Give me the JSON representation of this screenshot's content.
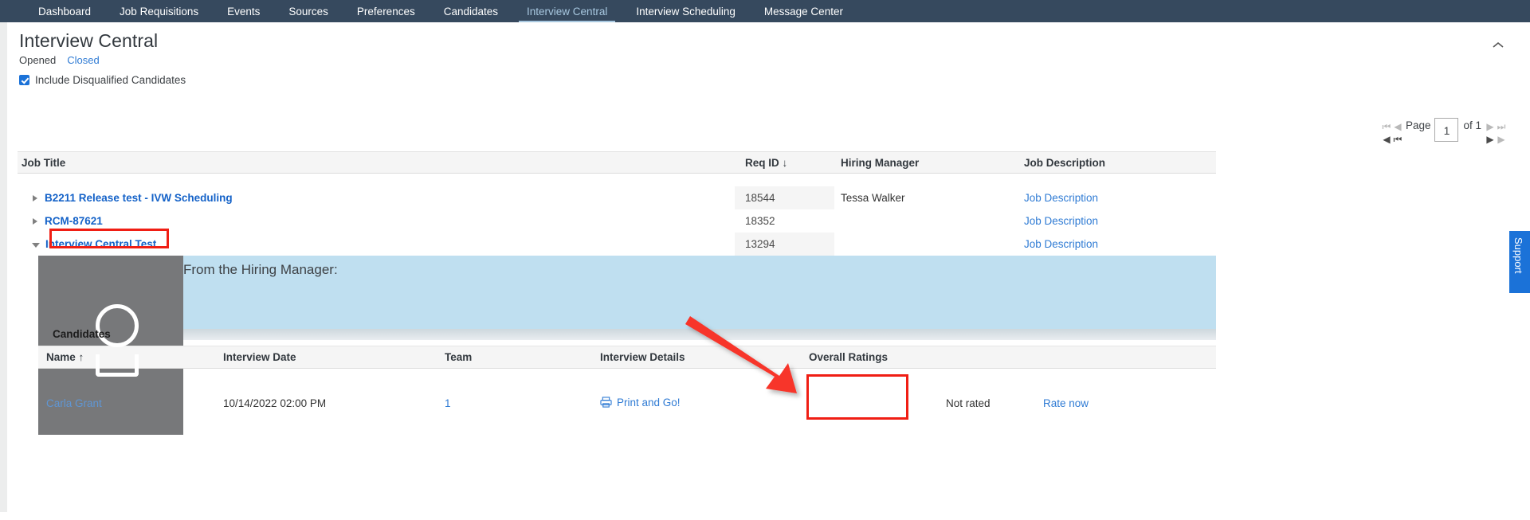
{
  "nav": {
    "items": [
      {
        "label": "Dashboard",
        "active": false
      },
      {
        "label": "Job Requisitions",
        "active": false
      },
      {
        "label": "Events",
        "active": false
      },
      {
        "label": "Sources",
        "active": false
      },
      {
        "label": "Preferences",
        "active": false
      },
      {
        "label": "Candidates",
        "active": false
      },
      {
        "label": "Interview Central",
        "active": true
      },
      {
        "label": "Interview Scheduling",
        "active": false
      },
      {
        "label": "Message Center",
        "active": false
      }
    ]
  },
  "header": {
    "title": "Interview Central",
    "subtabs": [
      {
        "label": "Opened",
        "active": true
      },
      {
        "label": "Closed",
        "active": false
      }
    ],
    "checkbox": {
      "label": "Include Disqualified Candidates",
      "checked": true
    },
    "collapse_icon": "chevron-up-icon"
  },
  "pager": {
    "page_word": "Page",
    "value": "1",
    "of_text": "of 1",
    "first_icon": "first-page-icon",
    "prev_icon": "prev-page-icon",
    "next_icon": "next-page-icon",
    "last_icon": "last-page-icon"
  },
  "jobs_table": {
    "columns": [
      "Job Title",
      "Req ID",
      "Hiring Manager",
      "Job Description"
    ],
    "sort": {
      "column": "Req ID",
      "indicator": "↓"
    },
    "rows": [
      {
        "title": "B2211 Release test - IVW Scheduling",
        "req_id": "18544",
        "hiring_manager": "Tessa Walker",
        "job_description": "Job Description",
        "expanded": false,
        "highlighted": false
      },
      {
        "title": "RCM-87621",
        "req_id": "18352",
        "hiring_manager": "",
        "job_description": "Job Description",
        "expanded": false,
        "highlighted": false
      },
      {
        "title": "Interview Central Test",
        "req_id": "13294",
        "hiring_manager": "",
        "job_description": "Job Description",
        "expanded": true,
        "highlighted": true
      }
    ]
  },
  "expanded_panel": {
    "hiring_manager_label": "From the Hiring Manager:",
    "candidates_label": "Candidates"
  },
  "candidates_table": {
    "columns": [
      "Name",
      "Interview Date",
      "Team",
      "Interview Details",
      "Overall Ratings"
    ],
    "sort": {
      "column": "Name",
      "indicator": "↑"
    },
    "rows": [
      {
        "name": "Carla Grant",
        "interview_date": "10/14/2022 02:00 PM",
        "team": "1",
        "interview_details": "Print and Go!",
        "print_icon": "printer-icon",
        "overall_rating": "",
        "rating_status": "Not rated",
        "rate_action": "Rate now"
      }
    ]
  },
  "support": {
    "label": "Support"
  },
  "annotations": {
    "arrow": "red-arrow-pointing-to-overall-ratings-cell",
    "title_box": "red-rectangle-around-interview-central-test",
    "rating_box": "red-rectangle-around-overall-ratings-cell"
  },
  "colors": {
    "navbar": "#36495e",
    "nav_active_text": "#a8c8e0",
    "link": "#2f7bd4",
    "job_link": "#1462c8",
    "annotation_red": "#f01e14",
    "panel_blue": "#bfdff0",
    "support_blue": "#1b72d8",
    "redaction_gray": "#77787a"
  }
}
